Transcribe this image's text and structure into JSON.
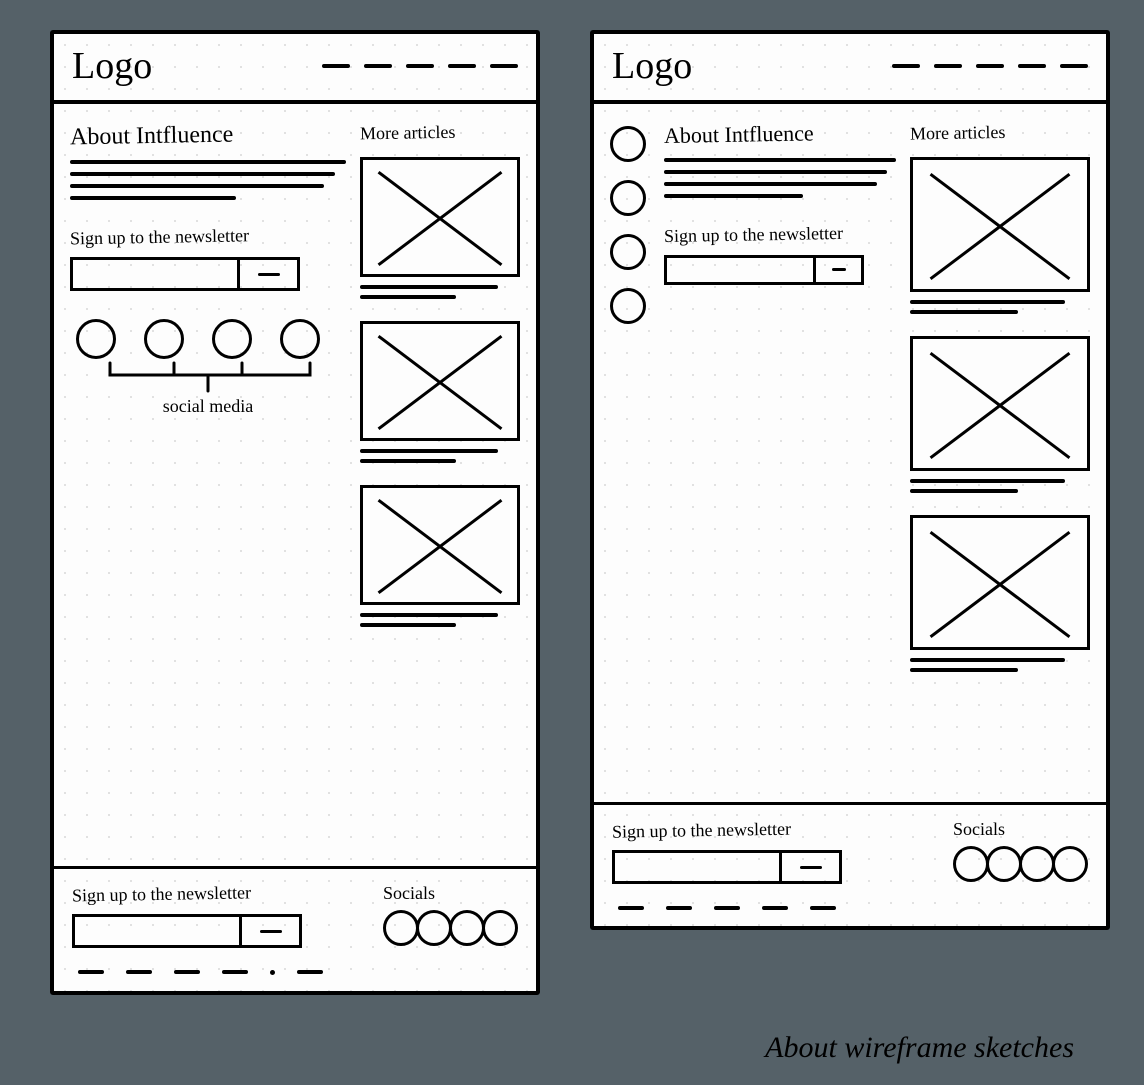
{
  "caption": "About wireframe sketches",
  "logo_text": "Logo",
  "nav_item_count": 5,
  "share_icon_count": 4,
  "frame1": {
    "heading": "About Intfluence",
    "newsletter_label": "Sign up to the newsletter",
    "social_caption": "social media",
    "sidebar_title": "More articles",
    "article_count": 3,
    "footer": {
      "newsletter_label": "Sign up to the newsletter",
      "socials_label": "Socials",
      "socials_count": 4,
      "footer_link_count": 5
    }
  },
  "frame2": {
    "heading": "About Intfluence",
    "newsletter_label": "Sign up to the newsletter",
    "sidebar_title": "More articles",
    "article_count": 3,
    "footer": {
      "newsletter_label": "Sign up to the newsletter",
      "socials_label": "Socials",
      "socials_count": 4,
      "footer_link_count": 5
    }
  }
}
